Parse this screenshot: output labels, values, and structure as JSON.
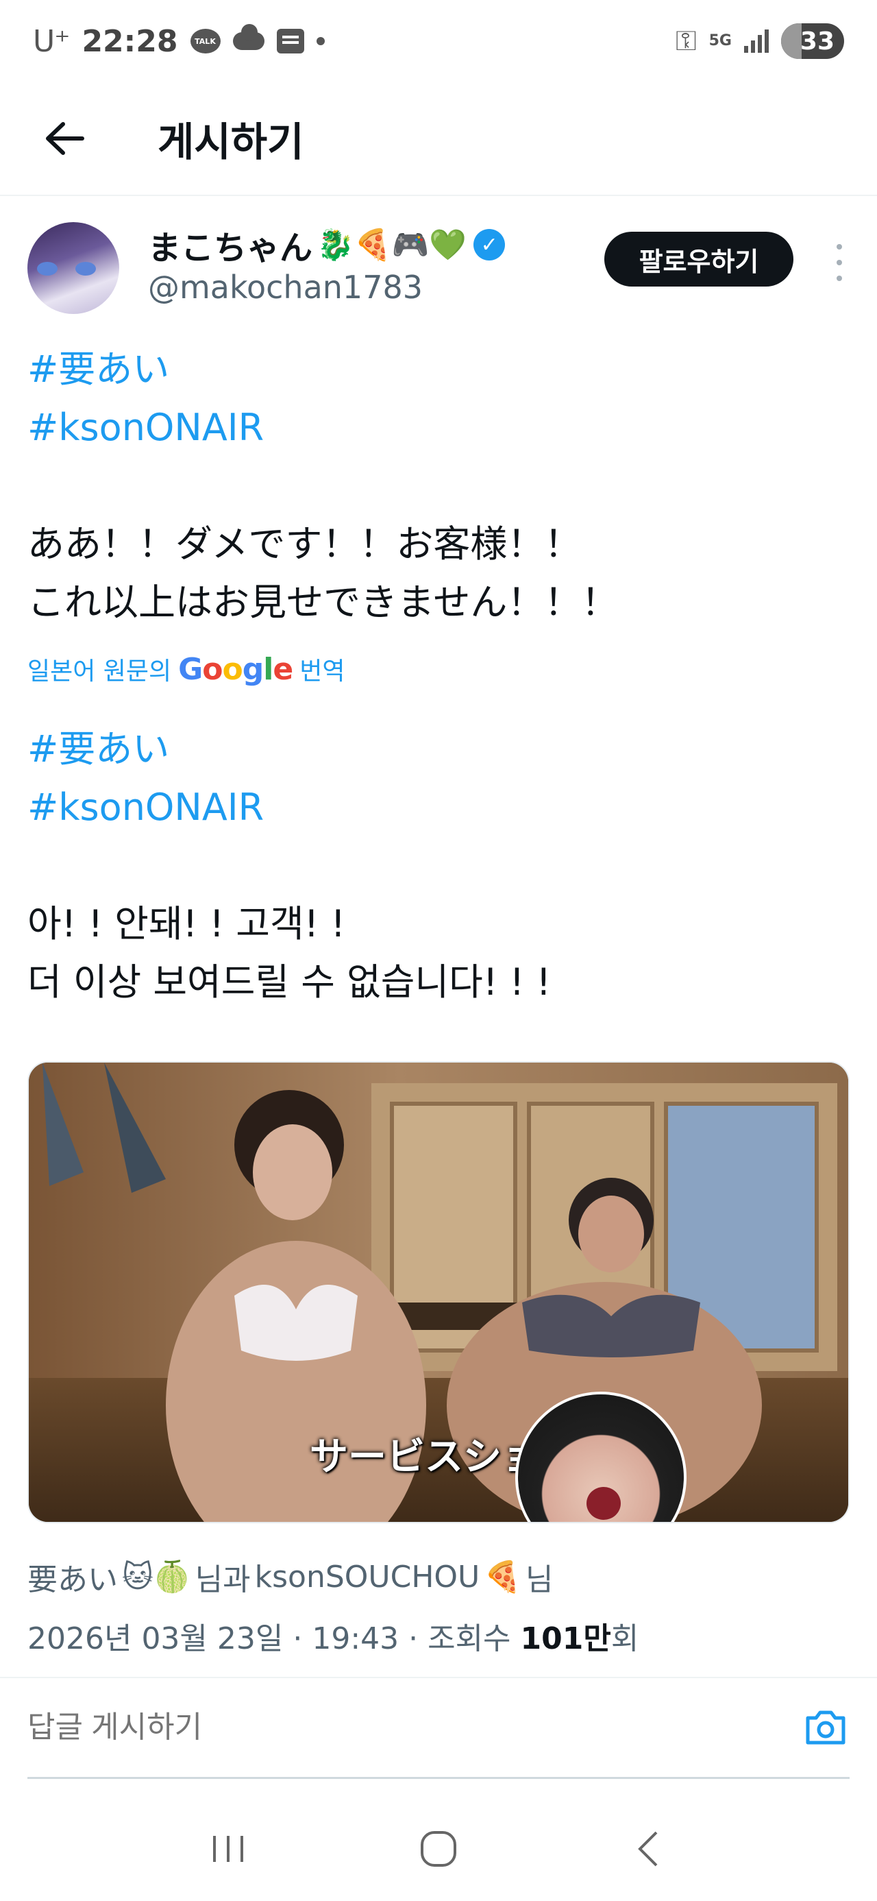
{
  "status_bar": {
    "carrier": "U⁺",
    "time": "22:28",
    "talk_icon": "TALK",
    "network": "5G",
    "battery": "33",
    "battery_level": 0.33
  },
  "header": {
    "title": "게시하기"
  },
  "author": {
    "display_name": "まこちゃん",
    "name_emojis": "🐉🍕🎮💚",
    "handle": "@makochan1783",
    "follow_label": "팔로우하기"
  },
  "post": {
    "hashtags": [
      "#要あい",
      "#ksonONAIR"
    ],
    "lines": [
      "ああ！！ダメです！！お客様！！",
      "これ以上はお見せできません！！！"
    ],
    "translate_prefix": "일본어 원문의",
    "translate_brand": [
      "G",
      "o",
      "o",
      "g",
      "l",
      "e"
    ],
    "translate_suffix": "번역",
    "translated_hashtags": [
      "#要あい",
      "#ksonONAIR"
    ],
    "translated_lines": [
      "아! ! 안돼! ! 고객! !",
      "더 이상 보여드릴 수 없습니다! ! !"
    ]
  },
  "media": {
    "caption": "サービスショ"
  },
  "tagged": {
    "user1": "要あい",
    "user1_emojis": "🐱🍈",
    "joiner": "님과",
    "user2": "ksonSOUCHOU",
    "user2_emoji": "🍕",
    "suffix": "님"
  },
  "meta": {
    "date": "2026년 03월 23일 · 19:43 · 조회수",
    "views": "101만",
    "views_suffix": "회"
  },
  "reply": {
    "placeholder": "답글 게시하기"
  }
}
